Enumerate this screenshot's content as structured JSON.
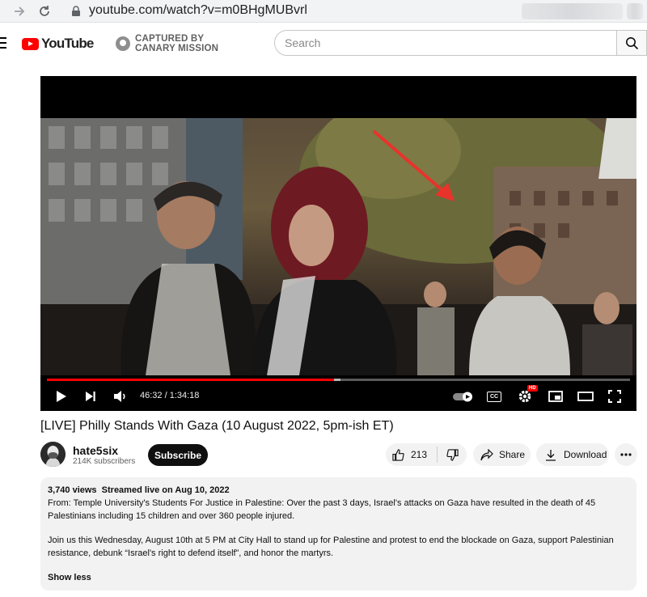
{
  "browser": {
    "url": "youtube.com/watch?v=m0BHgMUBvrl"
  },
  "header": {
    "logo_text": "YouTube",
    "badge_line1": "CAPTURED BY",
    "badge_line2": "CANARY MISSION",
    "search_placeholder": "Search"
  },
  "player": {
    "time_current": "46:32",
    "time_separator": " / ",
    "time_total": "1:34:18",
    "progress_fraction": 0.493,
    "buffered_fraction": 0.503,
    "settings_badge": "HD",
    "cc_label": "CC"
  },
  "video": {
    "title": "[LIVE] Philly Stands With Gaza (10 August 2022, 5pm-ish ET)",
    "channel_name": "hate5six",
    "subscribers": "214K subscribers",
    "subscribe_label": "Subscribe",
    "like_count": "213",
    "share_label": "Share",
    "download_label": "Download"
  },
  "description": {
    "meta": "3,740 views  Streamed live on Aug 10, 2022",
    "paragraph1": "From: Temple University's Students For Justice in Palestine: Over the past 3 days, Israel's attacks on Gaza have resulted in the death of 45 Palestinians including 15 children and over 360 people injured.",
    "paragraph2": "Join us this Wednesday, August 10th at 5 PM at City Hall to stand up for Palestine and protest to end the blockade on Gaza, support Palestinian resistance, debunk “Israel's right to defend itself”, and honor the martyrs.",
    "show_less": "Show less"
  },
  "colors": {
    "accent_red": "#ff0000",
    "text_primary": "#0f0f0f",
    "text_secondary": "#606060",
    "pill_bg": "#f2f2f2"
  }
}
